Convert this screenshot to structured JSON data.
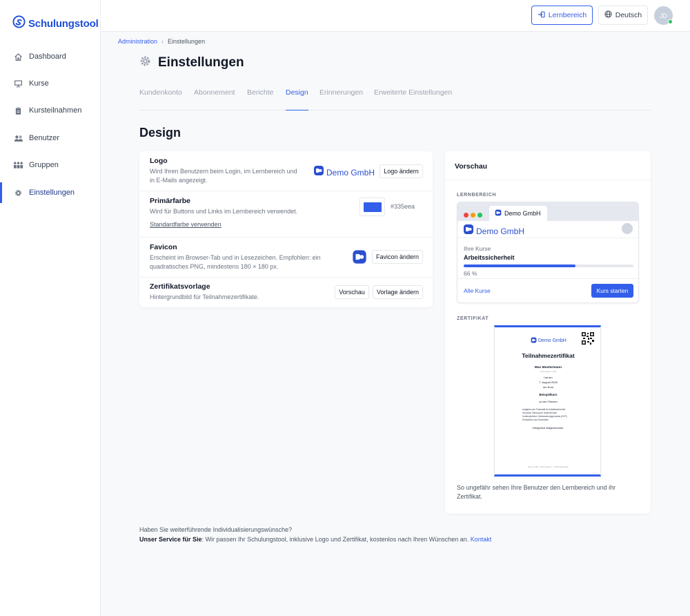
{
  "brand": {
    "name": "Schulungstool",
    "color": "#1d4ed8"
  },
  "sidebar": {
    "items": [
      {
        "label": "Dashboard",
        "icon": "home-icon"
      },
      {
        "label": "Kurse",
        "icon": "presentation-icon"
      },
      {
        "label": "Kursteilnahmen",
        "icon": "clipboard-icon"
      },
      {
        "label": "Benutzer",
        "icon": "users-icon"
      },
      {
        "label": "Gruppen",
        "icon": "groups-icon"
      },
      {
        "label": "Einstellungen",
        "icon": "gear-icon",
        "active": true
      }
    ]
  },
  "topbar": {
    "lernbereich_label": "Lernbereich",
    "language_label": "Deutsch",
    "avatar_initials": "JD"
  },
  "breadcrumb": {
    "parent": "Administration",
    "current": "Einstellungen"
  },
  "page": {
    "title": "Einstellungen"
  },
  "tabs": [
    {
      "label": "Kundenkonto"
    },
    {
      "label": "Abonnement"
    },
    {
      "label": "Berichte"
    },
    {
      "label": "Design",
      "active": true
    },
    {
      "label": "Erinnerungen"
    },
    {
      "label": "Erweiterte Einstellungen"
    }
  ],
  "section": {
    "title": "Design"
  },
  "settings": {
    "logo": {
      "title": "Logo",
      "desc_line1": "Wird Ihren Benutzern beim Login, im Lernbereich und",
      "desc_line2": "in E-Mails angezeigt.",
      "company": "Demo GmbH",
      "button": "Logo ändern"
    },
    "primary_color": {
      "title": "Primärfarbe",
      "desc": "Wird für Buttons und Links im Lernbereich verwendet.",
      "value": "#335eea",
      "reset_link": "Standardfarbe verwenden"
    },
    "favicon": {
      "title": "Favicon",
      "desc_line1": "Erscheint im Browser-Tab und in Lesezeichen. Empfohlen: ein",
      "desc_line2": "quadratisches PNG, mindestens 180 × 180 px.",
      "button": "Favicon ändern"
    },
    "certificate": {
      "title": "Zertifikatsvorlage",
      "desc": "Hintergrundbild für Teilnahmezertifikate.",
      "preview_button": "Vorschau",
      "change_button": "Vorlage ändern"
    }
  },
  "preview": {
    "title": "Vorschau",
    "learning_label": "LERNBEREICH",
    "tab_label": "Demo GmbH",
    "company": "Demo GmbH",
    "your_courses": "Ihre Kurse",
    "course_name": "Arbeitssicherheit",
    "progress_text": "66 %",
    "progress": 0.66,
    "all_courses": "Alle Kurse",
    "start_button": "Kurs starten",
    "certificate_label": "ZERTIFIKAT",
    "note": "So ungefähr sehen Ihre Benutzer den Lernbereich und ihr Zertifikat."
  },
  "certificate": {
    "company": "Demo GmbH",
    "title": "Teilnahmezertifikat",
    "name": "Max Mustermann",
    "name_sub": "Geburtsdatum: 1990",
    "hat_am": "hat am",
    "date": "7. August 2026",
    "am_kurs": "am Kurs",
    "course": "Beispielkurs",
    "zu_den": "zu den Themen",
    "topics": [
      "Aufgaben der Fachkraft für Arbeitssicherheit",
      "Gesunde Führung im Unternehmen",
      "Kontinuierlicher Verbesserungsprozess (KVP)",
      "Schweißen und Schneiden"
    ],
    "completed": "erfolgreich teilgenommen.",
    "footer": "Demo GmbH · Musterstraße 1 · 12345 Musterstadt"
  },
  "footer": {
    "question": "Haben Sie weiterführende Individualisierungswünsche?",
    "service_bold": "Unser Service für Sie",
    "service_text": ": Wir passen Ihr Schulungstool, inklusive Logo und Zertifikat, kostenlos nach Ihren Wünschen an. ",
    "contact_link": "Kontakt"
  }
}
